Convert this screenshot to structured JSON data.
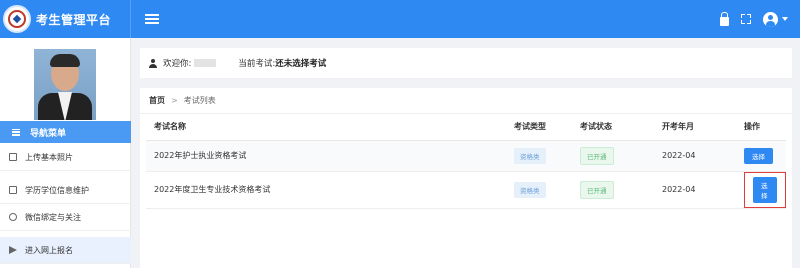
{
  "app": {
    "title": "考生管理平台"
  },
  "infobar": {
    "welcome_label": "欢迎你:",
    "current_exam_label": "当前考试:",
    "current_exam_value": "还未选择考试"
  },
  "sidebar": {
    "nav_header": "导航菜单",
    "items": [
      {
        "label": "上传基本照片"
      },
      {
        "label": "学历学位信息维护"
      },
      {
        "label": "微信绑定与关注"
      },
      {
        "label": "进入网上报名"
      }
    ]
  },
  "breadcrumb": {
    "home": "首页",
    "separator": ">",
    "current": "考试列表"
  },
  "table": {
    "headers": [
      "考试名称",
      "考试类型",
      "考试状态",
      "开考年月",
      "操作"
    ],
    "rows": [
      {
        "name": "2022年护士执业资格考试",
        "type": "资格类",
        "status": "已开通",
        "date": "2022-04",
        "action": "选择"
      },
      {
        "name": "2022年度卫生专业技术资格考试",
        "type": "资格类",
        "status": "已开通",
        "date": "2022-04",
        "action": "选择"
      }
    ]
  },
  "colors": {
    "primary": "#2f89f3",
    "nav_header": "#4a9af3",
    "highlight": "#e03c3c",
    "status_green": "#5cb87a"
  }
}
